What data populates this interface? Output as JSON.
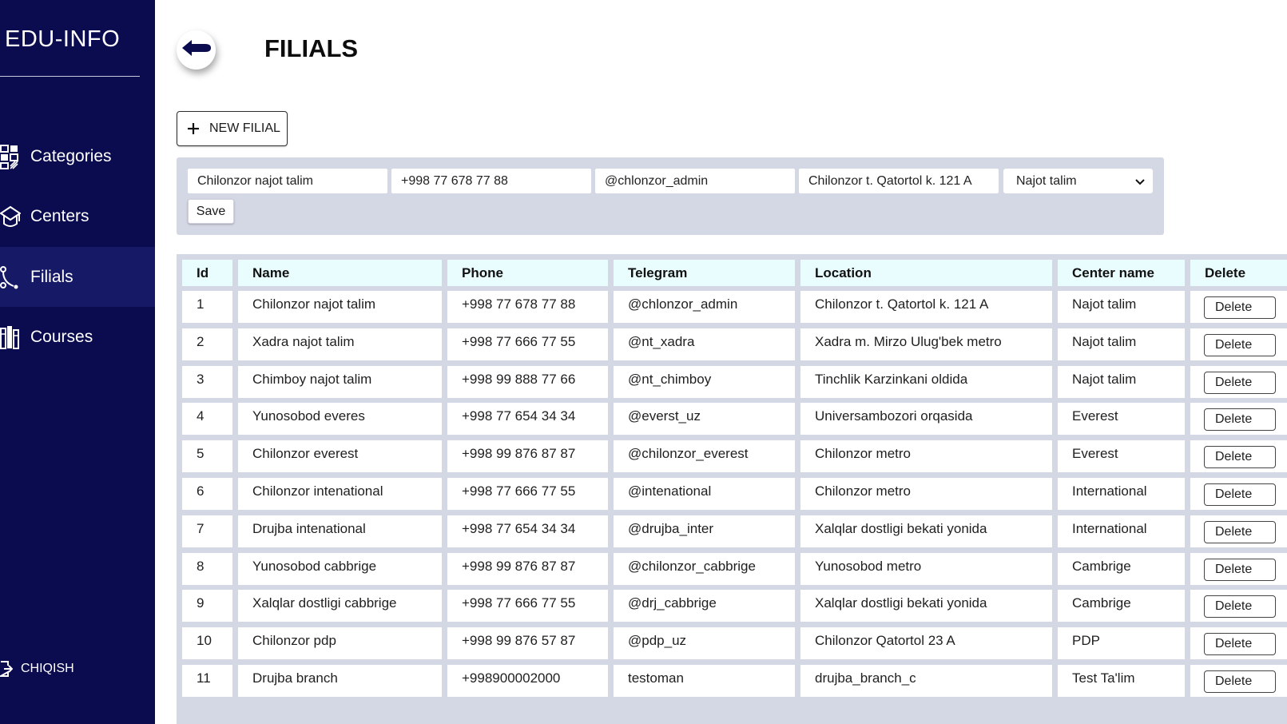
{
  "app": {
    "logo": "EDU-INFO"
  },
  "sidebar": {
    "items": [
      {
        "label": "Categories",
        "icon": "categories-icon"
      },
      {
        "label": "Centers",
        "icon": "centers-icon"
      },
      {
        "label": "Filials",
        "icon": "filials-icon",
        "active": true
      },
      {
        "label": "Courses",
        "icon": "courses-icon"
      }
    ],
    "logout_label": "CHIQISH"
  },
  "header": {
    "title": "FILIALS"
  },
  "toolbar": {
    "new_label": "NEW FILIAL"
  },
  "form": {
    "name": "Chilonzor najot talim",
    "phone": "+998 77 678 77 88",
    "telegram": "@chlonzor_admin",
    "location": "Chilonzor t. Qatortol k. 121 A",
    "center": "Najot talim",
    "save_label": "Save"
  },
  "table": {
    "columns": [
      "Id",
      "Name",
      "Phone",
      "Telegram",
      "Location",
      "Center name",
      "Delete"
    ],
    "delete_label": "Delete",
    "rows": [
      [
        "1",
        "Chilonzor najot talim",
        "+998 77 678 77 88",
        "@chlonzor_admin",
        "Chilonzor t. Qatortol k. 121 A",
        "Najot talim"
      ],
      [
        "2",
        "Xadra najot talim",
        "+998 77 666 77 55",
        "@nt_xadra",
        "Xadra m. Mirzo Ulug'bek metro",
        "Najot talim"
      ],
      [
        "3",
        "Chimboy najot talim",
        "+998 99 888 77 66",
        "@nt_chimboy",
        "Tinchlik Karzinkani oldida",
        "Najot talim"
      ],
      [
        "4",
        "Yunosobod everes",
        "+998 77 654 34 34",
        "@everst_uz",
        "Universambozori orqasida",
        "Everest"
      ],
      [
        "5",
        "Chilonzor everest",
        "+998 99 876 87 87",
        "@chilonzor_everest",
        "Chilonzor metro",
        "Everest"
      ],
      [
        "6",
        "Chilonzor intenational",
        "+998 77 666 77 55",
        "@intenational",
        "Chilonzor metro",
        "International"
      ],
      [
        "7",
        "Drujba intenational",
        "+998 77 654 34 34",
        "@drujba_inter",
        "Xalqlar dostligi bekati yonida",
        "International"
      ],
      [
        "8",
        "Yunosobod cabbrige",
        "+998 99 876 87 87",
        "@chilonzor_cabbrige",
        "Yunosobod metro",
        "Cambrige"
      ],
      [
        "9",
        "Xalqlar dostligi cabbrige",
        "+998 77 666 77 55",
        "@drj_cabbrige",
        "Xalqlar dostligi bekati yonida",
        "Cambrige"
      ],
      [
        "10",
        "Chilonzor pdp",
        "+998 99 876 57 87",
        "@pdp_uz",
        "Chilonzor Qatortol 23 A",
        "PDP"
      ],
      [
        "11",
        "Drujba branch",
        "+998900002000",
        "testoman",
        "drujba_branch_c",
        "Test Ta'lim"
      ]
    ]
  },
  "colors": {
    "sidebar_bg": "#0b0b4f",
    "sidebar_active": "#161a66",
    "panel_bg": "#d4d7e4",
    "header_cell_bg": "#eafdfe",
    "accent": "#0b0b4f"
  }
}
